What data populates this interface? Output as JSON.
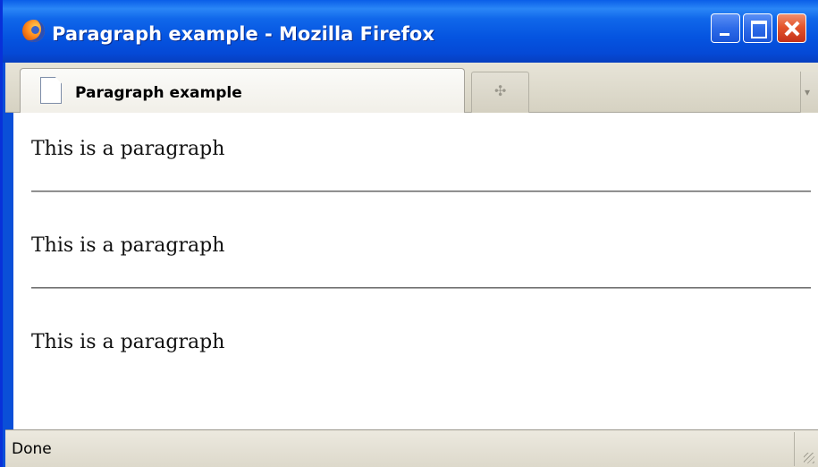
{
  "window": {
    "title": "Paragraph example - Mozilla Firefox",
    "controls": [
      "minimize-icon",
      "maximize-icon",
      "close-icon"
    ]
  },
  "tabs": [
    {
      "label": "Paragraph example",
      "icon": "page-icon",
      "active": true
    }
  ],
  "new_tab_glyph": "✣",
  "tab_list_glyph": "▾",
  "content": {
    "paragraphs": [
      "This is a paragraph",
      "This is a paragraph",
      "This is a paragraph"
    ]
  },
  "status": {
    "text": "Done"
  },
  "colors": {
    "titlebar": "#0554e0",
    "close_button": "#e4552c",
    "chrome": "#ece9df"
  }
}
